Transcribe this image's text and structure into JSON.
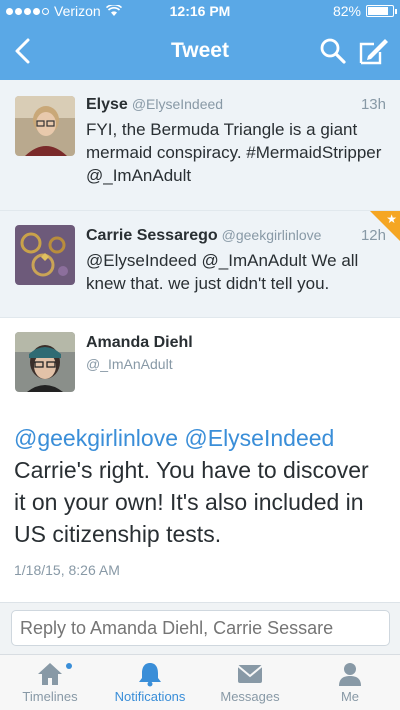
{
  "status_bar": {
    "carrier": "Verizon",
    "time": "12:16 PM",
    "battery": "82%",
    "battery_level": 0.82
  },
  "nav": {
    "title": "Tweet",
    "back_icon": "chevron-left-icon",
    "search_icon": "search-icon",
    "compose_icon": "compose-icon"
  },
  "tweets": [
    {
      "name": "Elyse",
      "handle": "@ElyseIndeed",
      "age": "13h",
      "text": "FYI, the Bermuda Triangle is a giant mermaid conspiracy. #MermaidStripper @_ImAnAdult"
    },
    {
      "name": "Carrie Sessarego",
      "handle": "@geekgirlinlove",
      "age": "12h",
      "text": "@ElyseIndeed @_ImAnAdult We all knew that.  we just didn't tell you.",
      "favorited": true
    }
  ],
  "main_tweet": {
    "name": "Amanda Diehl",
    "handle": "@_ImAnAdult",
    "mentions": "@geekgirlinlove @ElyseIndeed",
    "text": "Carrie's right. You have to discover it on your own! It's also included in US citizenship tests.",
    "date": "1/18/15, 8:26 AM"
  },
  "reply": {
    "placeholder": "Reply to Amanda Diehl, Carrie Sessare"
  },
  "tabs": [
    {
      "label": "Timelines",
      "icon": "home-icon",
      "active": false
    },
    {
      "label": "Notifications",
      "icon": "bell-icon",
      "active": true
    },
    {
      "label": "Messages",
      "icon": "envelope-icon",
      "active": false
    },
    {
      "label": "Me",
      "icon": "person-icon",
      "active": false
    }
  ],
  "colors": {
    "header": "#5aa8e6",
    "link": "#3a8ed8",
    "favorite": "#f5a623"
  }
}
